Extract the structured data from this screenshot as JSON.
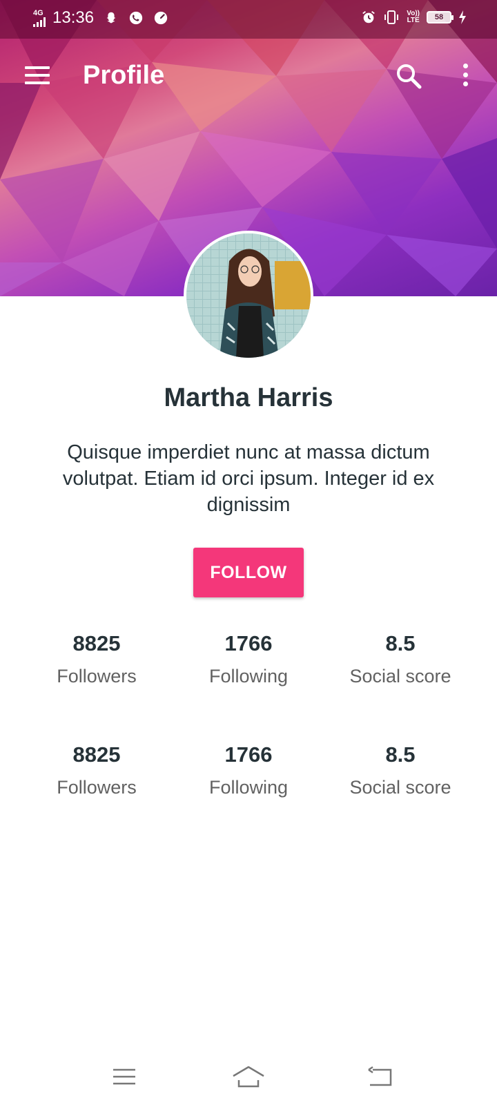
{
  "status_bar": {
    "network": "4G",
    "time": "13:36",
    "volte_top": "Vo))",
    "volte_bottom": "LTE",
    "battery": "58"
  },
  "app_bar": {
    "title": "Profile"
  },
  "profile": {
    "name": "Martha Harris",
    "bio": "Quisque imperdiet nunc at massa dictum volutpat. Etiam id orci ipsum. Integer id ex dignissim",
    "follow_label": "FOLLOW"
  },
  "stats_rows": [
    [
      {
        "value": "8825",
        "label": "Followers"
      },
      {
        "value": "1766",
        "label": "Following"
      },
      {
        "value": "8.5",
        "label": "Social score"
      }
    ],
    [
      {
        "value": "8825",
        "label": "Followers"
      },
      {
        "value": "1766",
        "label": "Following"
      },
      {
        "value": "8.5",
        "label": "Social score"
      }
    ]
  ],
  "colors": {
    "accent": "#f4377a",
    "text_primary": "#263238",
    "text_secondary": "#616161"
  },
  "icons": {
    "menu": "menu-icon",
    "search": "search-icon",
    "more": "more-vert-icon",
    "nav_recents": "recents-icon",
    "nav_home": "home-icon",
    "nav_back": "back-icon"
  }
}
